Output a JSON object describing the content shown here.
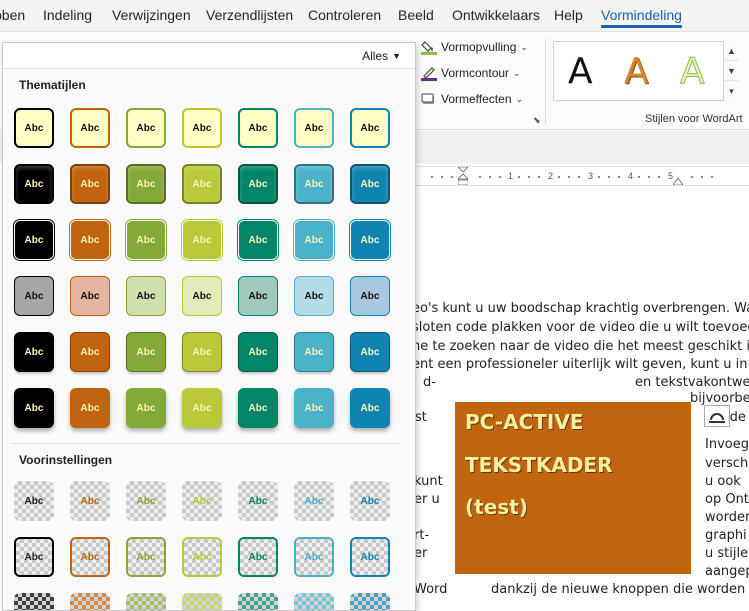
{
  "ribbon_tabs": [
    "bben",
    "Indeling",
    "Verwijzingen",
    "Verzendlijsten",
    "Controleren",
    "Beeld",
    "Ontwikkelaars",
    "Help",
    "Vormindeling"
  ],
  "active_tab": "Vormindeling",
  "ribbon": {
    "shape_fill": "Vormopvulling",
    "shape_outline": "Vormcontour",
    "shape_effects": "Vormeffecten",
    "wordart_letters": [
      "A",
      "A",
      "A"
    ],
    "wordart_group_label": "Stijlen voor WordArt",
    "group_launcher": "⬊",
    "scroll_glyphs": [
      "▲",
      "▼",
      "▾"
    ]
  },
  "gallery": {
    "filter_label": "Alles",
    "section_theme": "Thematijlen",
    "section_presets": "Voorinstellingen",
    "swatch_text": "Abc"
  },
  "theme_colors": {
    "dark": "#000000",
    "orange": "#c0640f",
    "green": "#84a938",
    "lime": "#b9c93a",
    "teal": "#028569",
    "aqua": "#4ab2c9",
    "blue": "#0f84b0",
    "light_row4": [
      "#a6a6a6",
      "#e4b49c",
      "#cfdfae",
      "#e4e9b9",
      "#a0c9ba",
      "#b3dce6",
      "#a7c8df"
    ],
    "preset_text_colors": [
      "#222222",
      "#c0640f",
      "#84a938",
      "#b9c93a",
      "#028569",
      "#4ab2c9",
      "#0f84b0"
    ]
  },
  "ruler": {
    "numbers": [
      "1",
      "2",
      "3",
      "4",
      "5"
    ]
  },
  "document": {
    "lines": [
      "eo's kunt u uw boodschap krachtig overbrengen. Wan",
      "sloten code plakken voor de video die u wilt toevoeg",
      "ne te zoeken naar de video die het meest geschikt is",
      "ent een professioneler uiterlijk wilt geven, kunt u in W",
      "d-",
      "en tekstvakontwer",
      "bijvoorbe",
      "st",
      "ide",
      "Invoeg",
      "versch",
      "kunt",
      "u ook",
      "er u",
      "op Ont",
      "worder",
      "rt-",
      "graphi",
      "er",
      "u stijle",
      "aangep",
      "Word",
      "dankzij de nieuwe knoppen die worden w"
    ],
    "textbox_lines": [
      "PC-ACTIVE",
      "TEKSTKADER",
      "(test)"
    ]
  }
}
